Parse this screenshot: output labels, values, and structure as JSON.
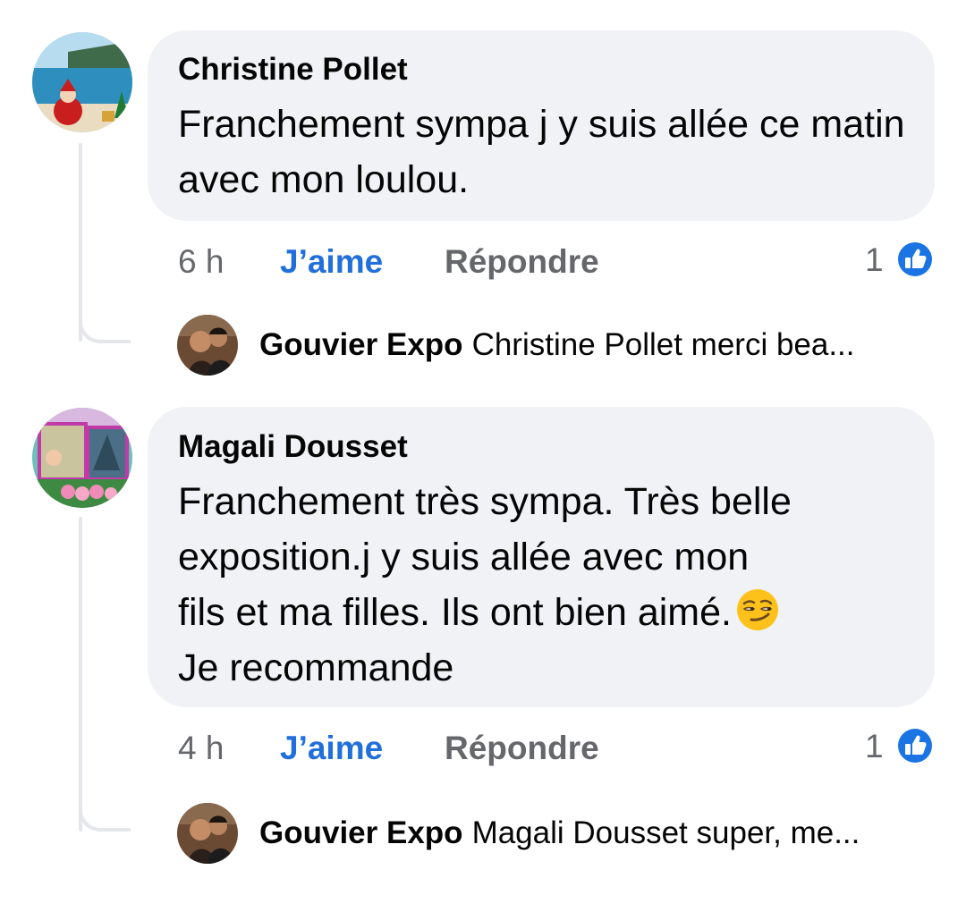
{
  "comments": [
    {
      "author": "Christine Pollet",
      "text": "Franchement sympa j y suis allée ce matin avec mon loulou.",
      "time": "6 h",
      "like_label": "J’aime",
      "reply_label": "Répondre",
      "reaction_count": "1",
      "reaction_icon": "thumbs-up-icon",
      "reply_preview": {
        "author": "Gouvier Expo",
        "text": "Christine Pollet merci bea..."
      }
    },
    {
      "author": "Magali Dousset",
      "text_lines": [
        "Franchement très sympa. Très belle",
        "exposition.j y suis allée avec mon",
        "fils et ma filles. Ils ont bien aimé.",
        "Je recommande"
      ],
      "emoji": "smirking-face-icon",
      "time": "4 h",
      "like_label": "J’aime",
      "reply_label": "Répondre",
      "reaction_count": "1",
      "reaction_icon": "thumbs-up-icon",
      "reply_preview": {
        "author": "Gouvier Expo",
        "text": "Magali Dousset super, me..."
      }
    }
  ],
  "colors": {
    "bubble": "#f0f2f5",
    "link_blue": "#216fdb",
    "secondary_text": "#65676b",
    "thread_line": "#e4e6eb"
  }
}
